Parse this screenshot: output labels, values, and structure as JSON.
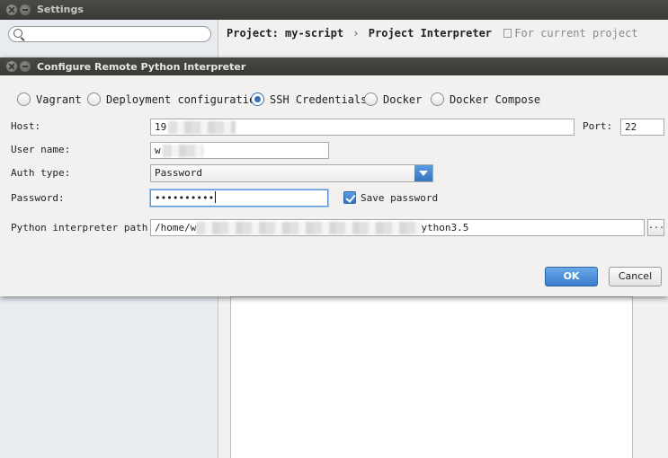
{
  "settings": {
    "title": "Settings",
    "breadcrumb": {
      "project": "Project:",
      "project_name": "my-script",
      "separator": "›",
      "page": "Project Interpreter",
      "scope": "For current project"
    }
  },
  "dialog": {
    "title": "Configure Remote Python Interpreter",
    "radios": [
      {
        "label": "Vagrant",
        "selected": false
      },
      {
        "label": "Deployment configuration",
        "selected": false
      },
      {
        "label": "SSH Credentials",
        "selected": true
      },
      {
        "label": "Docker",
        "selected": false
      },
      {
        "label": "Docker Compose",
        "selected": false
      }
    ],
    "host": {
      "label": "Host:",
      "value": "19"
    },
    "port": {
      "label": "Port:",
      "value": "22"
    },
    "username": {
      "label": "User name:",
      "value": "w"
    },
    "auth_type": {
      "label": "Auth type:",
      "value": "Password"
    },
    "password": {
      "label": "Password:",
      "value": "••••••••••"
    },
    "save_password": {
      "label": "Save password",
      "checked": true
    },
    "interpreter_path": {
      "label": "Python interpreter path:",
      "value_start": "/home/w",
      "value_end": "ython3.5",
      "browse_label": "..."
    },
    "ok_label": "OK",
    "cancel_label": "Cancel"
  }
}
